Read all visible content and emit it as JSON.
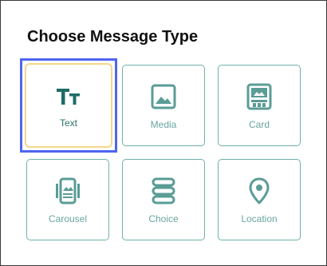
{
  "title": "Choose Message Type",
  "colors": {
    "accent": "#5a9c96",
    "accent_dark": "#1e6c66",
    "tile_border": "#6fb1ab",
    "selected_border": "#f5d68a",
    "focus_ring": "#4f65f0"
  },
  "selected": "Text",
  "types": [
    {
      "label": "Text",
      "icon": "text-format-icon"
    },
    {
      "label": "Media",
      "icon": "image-icon"
    },
    {
      "label": "Card",
      "icon": "card-icon"
    },
    {
      "label": "Carousel",
      "icon": "carousel-icon"
    },
    {
      "label": "Choice",
      "icon": "choice-list-icon"
    },
    {
      "label": "Location",
      "icon": "location-pin-icon"
    }
  ]
}
